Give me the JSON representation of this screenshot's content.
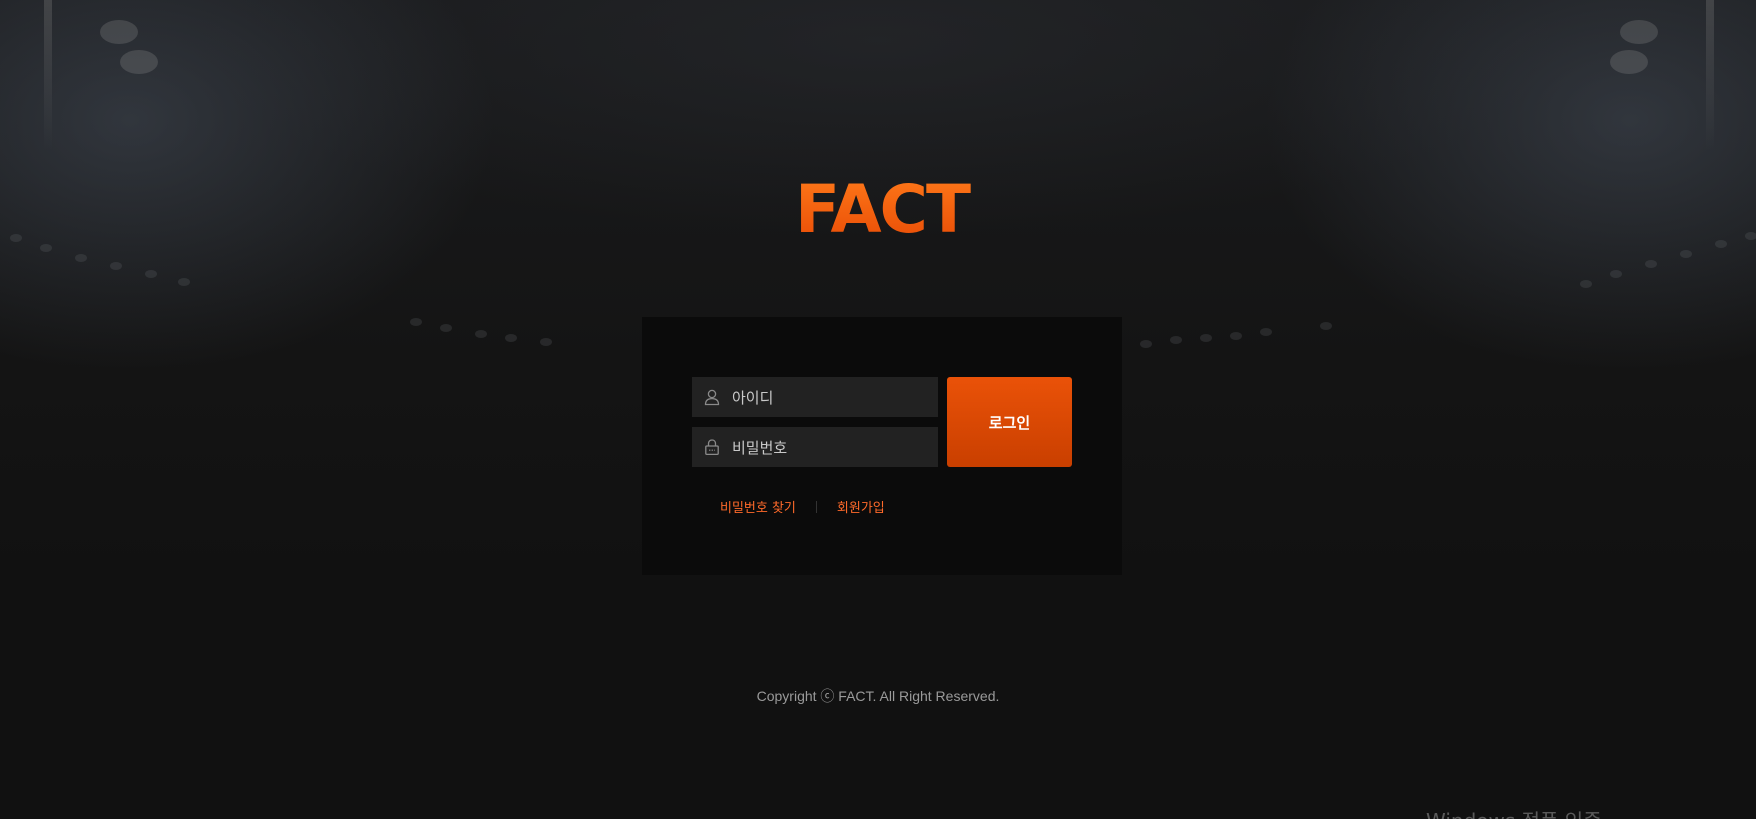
{
  "brand": {
    "logo_text": "FACT",
    "accent_color": "#ea5208",
    "link_color": "#ff6a2a"
  },
  "login_form": {
    "id_placeholder": "아이디",
    "id_icon": "user-icon",
    "password_placeholder": "비밀번호",
    "password_icon": "lock-icon",
    "login_button_label": "로그인"
  },
  "links": {
    "find_password": "비밀번호 찾기",
    "sign_up": "회원가입"
  },
  "footer": {
    "copyright": "Copyright ⓒ FACT. All Right Reserved."
  },
  "os_watermark": {
    "text": "Windows 정품 인증"
  }
}
